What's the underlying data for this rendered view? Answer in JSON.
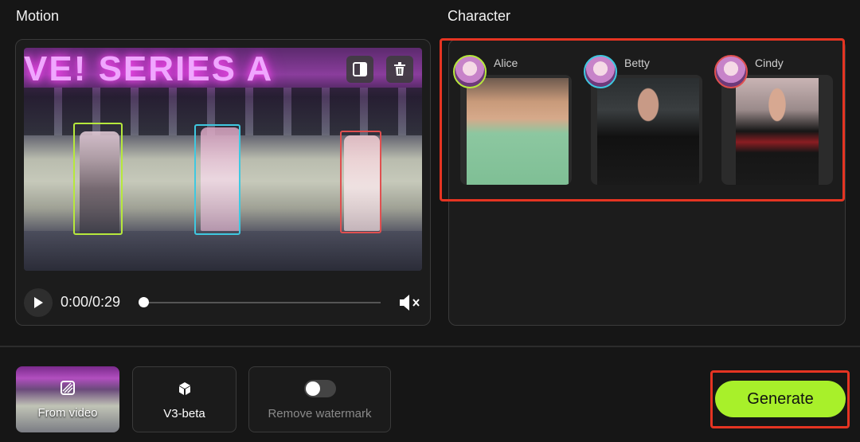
{
  "motion": {
    "title": "Motion",
    "stage_text": "VE! SERIES A",
    "time": "0:00/0:29",
    "progress": 0.0
  },
  "character": {
    "title": "Character",
    "items": [
      {
        "name": "Alice",
        "ring_color": "#b6e83c"
      },
      {
        "name": "Betty",
        "ring_color": "#3fc8e0"
      },
      {
        "name": "Cindy",
        "ring_color": "#e05050"
      }
    ]
  },
  "toolbar": {
    "from_video": "From video",
    "model": "V3-beta",
    "remove_watermark": "Remove watermark",
    "watermark_enabled": false,
    "generate": "Generate"
  },
  "colors": {
    "accent": "#a8f02a",
    "highlight": "#e53422"
  }
}
